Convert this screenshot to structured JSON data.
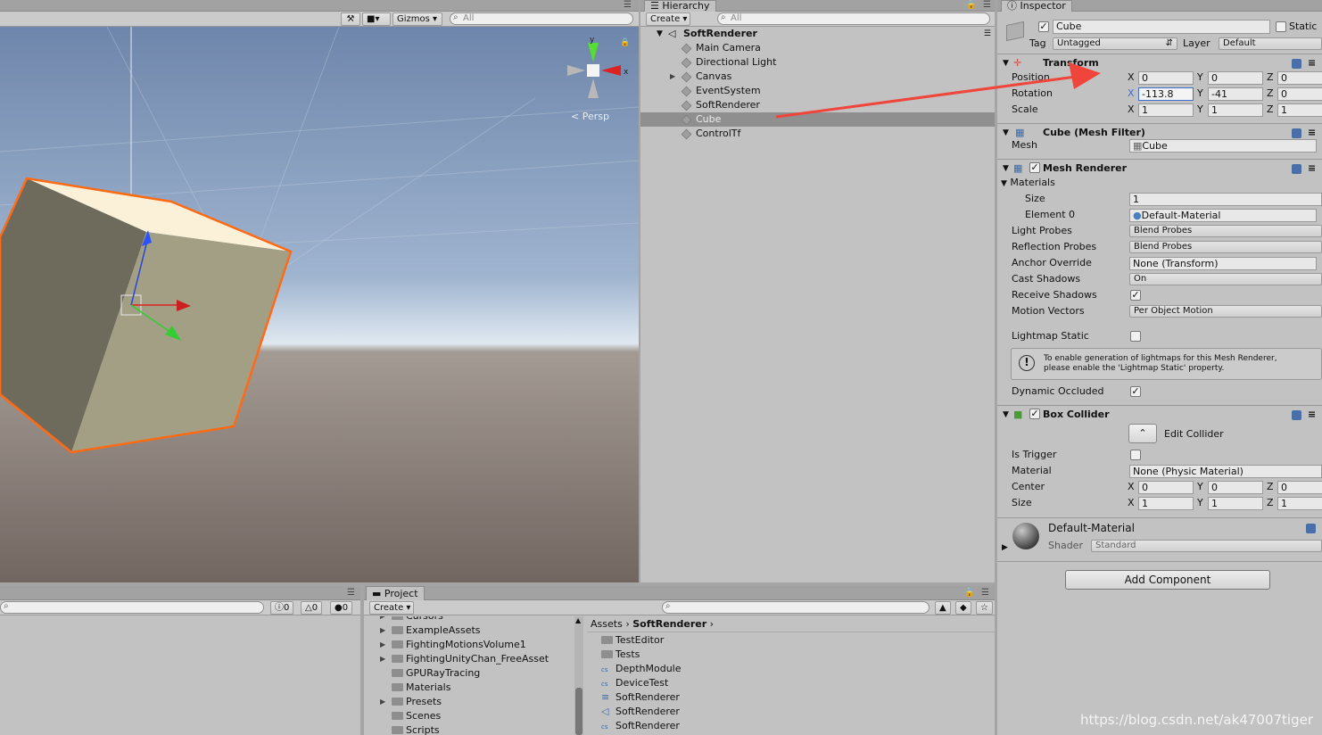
{
  "scene": {
    "gizmos_label": "Gizmos",
    "search_placeholder": "All",
    "persp_label": "Persp",
    "gizmo_y": "y",
    "gizmo_x": "x"
  },
  "hierarchy": {
    "tab_label": "Hierarchy",
    "create_label": "Create",
    "search_placeholder": "All",
    "scene_name": "SoftRenderer",
    "items": [
      {
        "label": "Main Camera"
      },
      {
        "label": "Directional Light"
      },
      {
        "label": "Canvas",
        "has_children": true
      },
      {
        "label": "EventSystem"
      },
      {
        "label": "SoftRenderer"
      },
      {
        "label": "Cube",
        "selected": true
      },
      {
        "label": "ControlTf"
      }
    ]
  },
  "inspector": {
    "tab_label": "Inspector",
    "object_name": "Cube",
    "static_label": "Static",
    "tag_label": "Tag",
    "tag_value": "Untagged",
    "layer_label": "Layer",
    "layer_value": "Default",
    "transform": {
      "title": "Transform",
      "position_label": "Position",
      "rotation_label": "Rotation",
      "scale_label": "Scale",
      "position": {
        "x": "0",
        "y": "0",
        "z": "0"
      },
      "rotation": {
        "x": "-113.8",
        "y": "-41",
        "z": "0"
      },
      "scale": {
        "x": "1",
        "y": "1",
        "z": "1"
      }
    },
    "mesh_filter": {
      "title": "Cube (Mesh Filter)",
      "mesh_label": "Mesh",
      "mesh_value": "Cube"
    },
    "mesh_renderer": {
      "title": "Mesh Renderer",
      "materials_label": "Materials",
      "size_label": "Size",
      "size_value": "1",
      "element0_label": "Element 0",
      "element0_value": "Default-Material",
      "light_probes_label": "Light Probes",
      "light_probes_value": "Blend Probes",
      "reflection_probes_label": "Reflection Probes",
      "reflection_probes_value": "Blend Probes",
      "anchor_override_label": "Anchor Override",
      "anchor_override_value": "None (Transform)",
      "cast_shadows_label": "Cast Shadows",
      "cast_shadows_value": "On",
      "receive_shadows_label": "Receive Shadows",
      "motion_vectors_label": "Motion Vectors",
      "motion_vectors_value": "Per Object Motion",
      "lightmap_static_label": "Lightmap Static",
      "info_line1": "To enable generation of lightmaps for this Mesh Renderer,",
      "info_line2": "please enable the 'Lightmap Static' property.",
      "dynamic_occluded_label": "Dynamic Occluded"
    },
    "box_collider": {
      "title": "Box Collider",
      "edit_collider_label": "Edit Collider",
      "is_trigger_label": "Is Trigger",
      "material_label": "Material",
      "material_value": "None (Physic Material)",
      "center_label": "Center",
      "size_label": "Size",
      "center": {
        "x": "0",
        "y": "0",
        "z": "0"
      },
      "size": {
        "x": "1",
        "y": "1",
        "z": "1"
      }
    },
    "material_preview": {
      "name": "Default-Material",
      "shader_label": "Shader",
      "shader_value": "Standard"
    },
    "add_component_label": "Add Component"
  },
  "console": {
    "count_info": "0",
    "count_warn": "0",
    "count_error": "0"
  },
  "project": {
    "tab_label": "Project",
    "create_label": "Create",
    "folders": [
      "Cursors",
      "ExampleAssets",
      "FightingMotionsVolume1",
      "FightingUnityChan_FreeAsset",
      "GPURayTracing",
      "Materials",
      "Presets",
      "Scenes",
      "Scripts"
    ],
    "breadcrumb_root": "Assets",
    "breadcrumb_current": "SoftRenderer",
    "files": [
      {
        "name": "TestEditor",
        "kind": "folder"
      },
      {
        "name": "Tests",
        "kind": "folder"
      },
      {
        "name": "DepthModule",
        "kind": "script"
      },
      {
        "name": "DeviceTest",
        "kind": "script"
      },
      {
        "name": "SoftRenderer",
        "kind": "asset"
      },
      {
        "name": "SoftRenderer",
        "kind": "scene"
      },
      {
        "name": "SoftRenderer",
        "kind": "script"
      }
    ]
  },
  "watermark": "https://blog.csdn.net/ak47007tiger"
}
